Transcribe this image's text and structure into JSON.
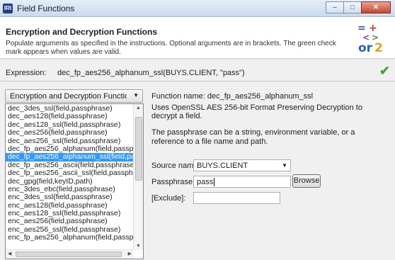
{
  "window": {
    "title": "Field Functions",
    "app_icon": "IRI",
    "minimize": "–",
    "maximize": "□",
    "close": "✕"
  },
  "header": {
    "title": "Encryption and Decryption Functions",
    "description": "Populate arguments as specified in the instructions. Optional arguments are in brackets. The green check mark appears when values are valid."
  },
  "expression": {
    "label": "Expression:",
    "value": "dec_fp_aes256_alphanum_ssl(BUYS.CLIENT, \"pass\")",
    "valid": true
  },
  "category": {
    "selected": "Encryption and Decryption Functions"
  },
  "functions": [
    "dec_3des_ssl(field,passphrase)",
    "dec_aes128(field,passphrase)",
    "dec_aes128_ssl(field,passphrase)",
    "dec_aes256(field,passphrase)",
    "dec_aes256_ssl(field,passphrase)",
    "dec_fp_aes256_alphanum(field,passp",
    "dec_fp_aes256_alphanum_ssl(field,pa",
    "dec_fp_aes256_ascii(field,passphrase,",
    "dec_fp_aes256_ascii_ssl(field,passphr",
    "dec_gpg(field,keyID,path)",
    "enc_3des_ebc(field,passphrase)",
    "enc_3des_ssl(field,passphrase)",
    "enc_aes128(field,passphrase)",
    "enc_aes128_ssl(field,passphrase)",
    "enc_aes256(field,passphrase)",
    "enc_aes256_ssl(field,passphrase)",
    "enc_fp_aes256_alphanum(field,passp"
  ],
  "selected_function_index": 6,
  "details": {
    "function_name_label": "Function name:",
    "function_name": "dec_fp_aes256_alphanum_ssl",
    "description": "Uses OpenSSL AES 256-bit Format Preserving Decryption to decrypt a field.",
    "note": "The passphrase can be a string, environment variable, or a reference to a file name and path."
  },
  "form": {
    "source_label": "Source name:",
    "source_value": "BUYS.CLIENT",
    "passphrase_label": "Passphrase:",
    "passphrase_value": "pass",
    "browse_label": "Browse",
    "exclude_label": "[Exclude]:",
    "exclude_value": ""
  },
  "colors": {
    "valid_check": "#46a72c",
    "selection": "#3399ff"
  },
  "icons": [
    "app-icon",
    "window-minimize-icon",
    "window-maximize-icon",
    "window-close-icon",
    "functions-logo",
    "check-icon",
    "dropdown-arrow-icon",
    "scroll-arrow-icon"
  ]
}
